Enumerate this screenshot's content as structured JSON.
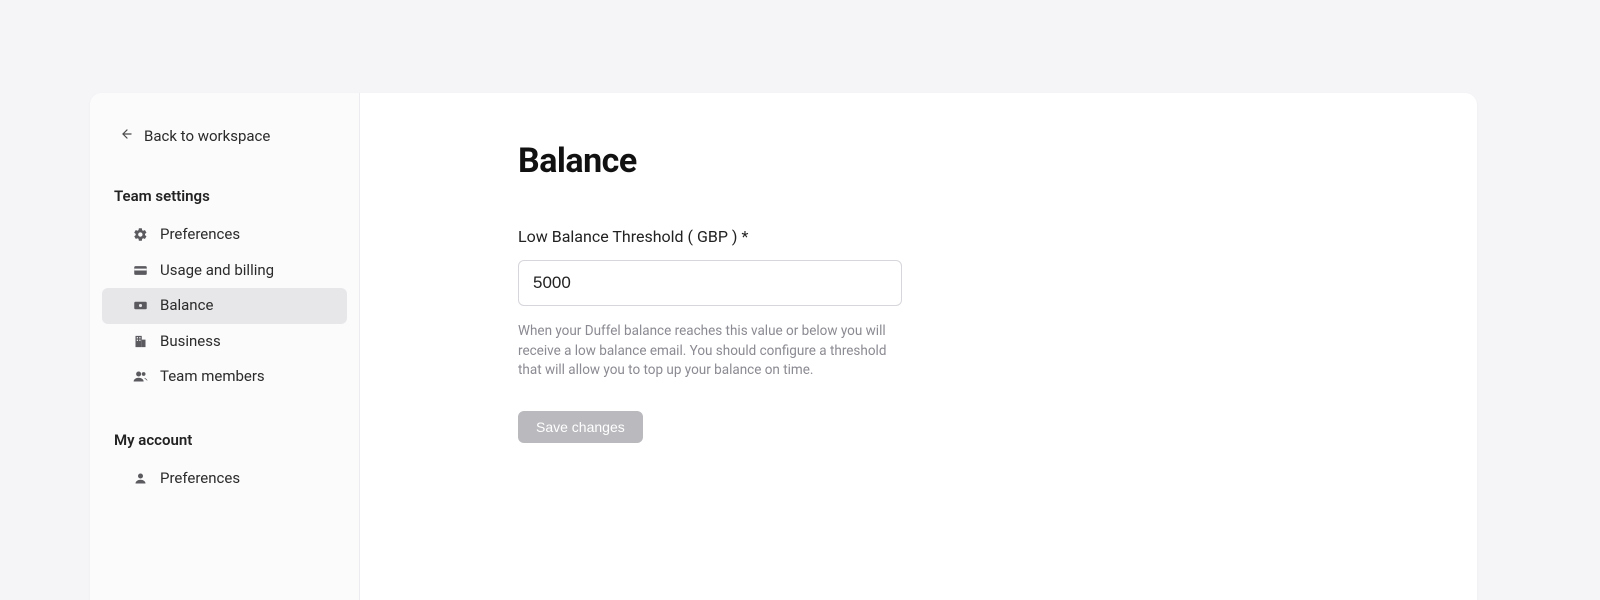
{
  "sidebar": {
    "back_label": "Back to workspace",
    "team_heading": "Team settings",
    "account_heading": "My account",
    "items": {
      "preferences": "Preferences",
      "usage_billing": "Usage and billing",
      "balance": "Balance",
      "business": "Business",
      "team_members": "Team members",
      "account_preferences": "Preferences"
    }
  },
  "main": {
    "title": "Balance",
    "threshold_label": "Low Balance Threshold ( GBP ) *",
    "threshold_value": "5000",
    "threshold_help": "When your Duffel balance reaches this value or below you will receive a low balance email. You should configure a threshold that will allow you to top up your balance on time.",
    "save_label": "Save changes"
  }
}
